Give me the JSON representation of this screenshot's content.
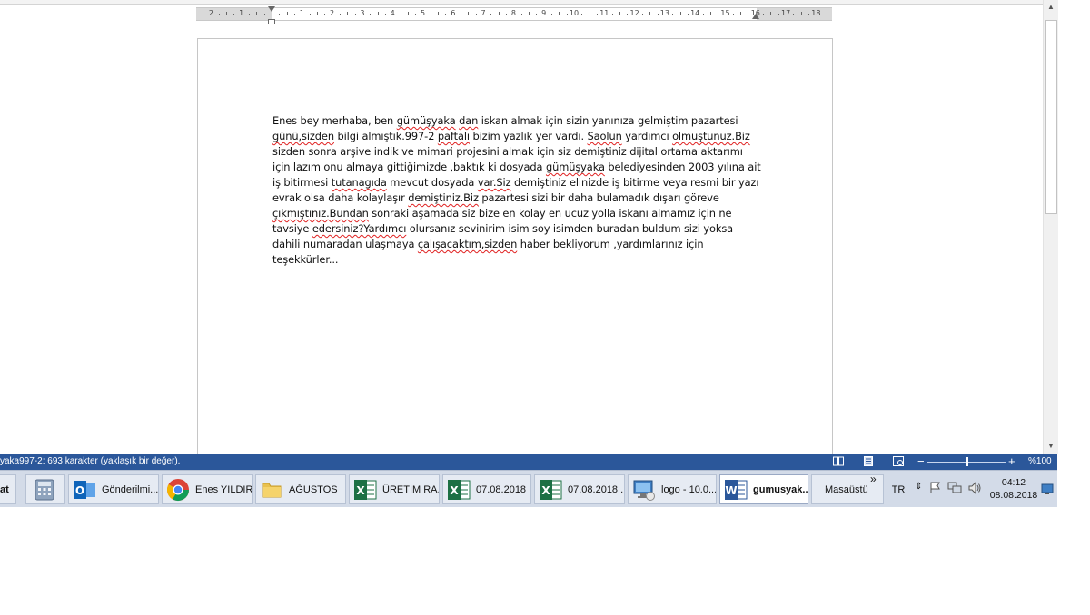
{
  "document": {
    "paragraph_segments": [
      {
        "t": "Enes bey merhaba, ben ",
        "err": false
      },
      {
        "t": "gümüşyaka",
        "err": true
      },
      {
        "t": " ",
        "err": false
      },
      {
        "t": "dan",
        "err": true
      },
      {
        "t": " iskan almak için sizin yanınıza gelmiştim pazartesi ",
        "err": false
      },
      {
        "t": "günü,sizden",
        "err": true
      },
      {
        "t": " bilgi almıştık.997-2 ",
        "err": false
      },
      {
        "t": "paftalı",
        "err": true
      },
      {
        "t": " bizim yazlık yer vardı. ",
        "err": false
      },
      {
        "t": "Saolun",
        "err": true
      },
      {
        "t": " yardımcı ",
        "err": false
      },
      {
        "t": "olmuştunuz.Biz",
        "err": true
      },
      {
        "t": " sizden sonra arşive indik ve mimari projesini almak için siz demiştiniz dijital ortama aktarımı için lazım onu almaya gittiğimizde ,baktık ki dosyada ",
        "err": false
      },
      {
        "t": "gümüşyaka",
        "err": true
      },
      {
        "t": " belediyesinden 2003 yılına ait iş bitirmesi ",
        "err": false
      },
      {
        "t": "tutanagıda",
        "err": true
      },
      {
        "t": " mevcut dosyada ",
        "err": false
      },
      {
        "t": "var.Siz",
        "err": true
      },
      {
        "t": " demiştiniz elinizde iş bitirme veya resmi bir yazı evrak olsa daha kolaylaşır ",
        "err": false
      },
      {
        "t": "demiştiniz.Biz",
        "err": true
      },
      {
        "t": " pazartesi sizi bir daha bulamadık dışarı göreve ",
        "err": false
      },
      {
        "t": "çıkmıştınız.Bundan",
        "err": true
      },
      {
        "t": " sonraki aşamada siz bize en kolay en ucuz yolla iskanı almamız için ne tavsiye ",
        "err": false
      },
      {
        "t": "edersiniz?Yardımcı",
        "err": true
      },
      {
        "t": " olursanız sevinirim isim soy isimden buradan buldum sizi yoksa dahili numaradan ulaşmaya ",
        "err": false
      },
      {
        "t": "çalışacaktım,sizden",
        "err": true
      },
      {
        "t": " haber bekliyorum ,yardımlarınız için teşekkürler...",
        "err": false
      }
    ]
  },
  "ruler": {
    "labels": [
      "2",
      "1",
      "1",
      "2",
      "3",
      "4",
      "5",
      "6",
      "7",
      "8",
      "9",
      "10",
      "11",
      "12",
      "13",
      "14",
      "15",
      "16",
      "17",
      "18"
    ]
  },
  "statusbar": {
    "text": "yaka997-2: 693 karakter (yaklaşık bir değer).",
    "zoom_minus": "−",
    "zoom_plus": "+",
    "zoom_level": "%100",
    "zoom_fraction": 0.5,
    "accent_color": "#2b579a"
  },
  "taskbar": {
    "start_fragment": "lat",
    "items": [
      {
        "icon": "calculator-icon",
        "label": ""
      },
      {
        "icon": "outlook-icon",
        "label": "Gönderilmi..."
      },
      {
        "icon": "chrome-icon",
        "label": "Enes YILDIR..."
      },
      {
        "icon": "folder-icon",
        "label": "AĞUSTOS"
      },
      {
        "icon": "excel-icon",
        "label": "ÜRETİM RA..."
      },
      {
        "icon": "excel-icon",
        "label": "07.08.2018 ..."
      },
      {
        "icon": "excel-icon",
        "label": "07.08.2018 ..."
      },
      {
        "icon": "remote-desktop-icon",
        "label": "logo - 10.0...."
      },
      {
        "icon": "word-icon",
        "label": "gumusyak..."
      }
    ],
    "desktop_label": "Masaüstü",
    "chevron": "»",
    "language": "TR",
    "tray_up_arrow": "⇕",
    "clock_time": "04:12",
    "clock_date": "08.08.2018"
  }
}
